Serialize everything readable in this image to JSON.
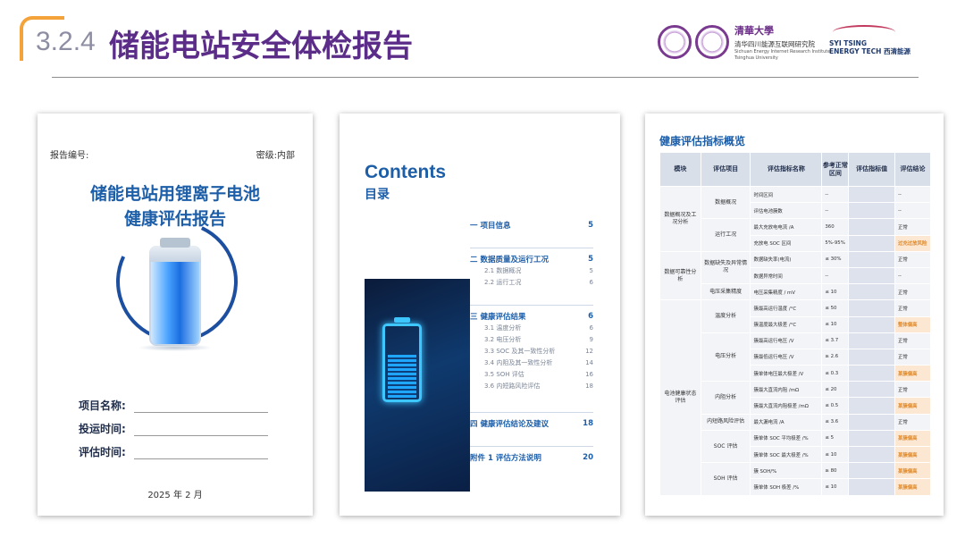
{
  "header": {
    "section_number": "3.2.4",
    "section_title": "储能电站安全体检报告",
    "institute_logo_text": "清華大學",
    "institute_cn": "清华四川能源互联网研究院",
    "institute_en_1": "Sichuan Energy Internet Research Institute",
    "institute_en_2": "Tsinghua University",
    "company_line1": "SYI TSING",
    "company_line2": "ENERGY TECH 西清能源"
  },
  "cover": {
    "report_no_label": "报告编号:",
    "secrecy_label": "密级:内部",
    "title_line1": "储能电站用锂离子电池",
    "title_line2": "健康评估报告",
    "fields": [
      "项目名称:",
      "投运时间:",
      "评估时间:"
    ],
    "date": "2025 年 2 月"
  },
  "contents": {
    "title_en": "Contents",
    "title_cn": "目录",
    "items": [
      {
        "num": "一",
        "label": "项目信息",
        "page": "5",
        "subs": []
      },
      {
        "num": "二",
        "label": "数据质量及运行工况",
        "page": "5",
        "subs": [
          {
            "label": "2.1 数据概况",
            "page": "5"
          },
          {
            "label": "2.2 运行工况",
            "page": "6"
          }
        ]
      },
      {
        "num": "三",
        "label": "健康评估结果",
        "page": "6",
        "subs": [
          {
            "label": "3.1 温度分析",
            "page": "6"
          },
          {
            "label": "3.2 电压分析",
            "page": "9"
          },
          {
            "label": "3.3 SOC 及其一致性分析",
            "page": "12"
          },
          {
            "label": "3.4 内阻及其一致性分析",
            "page": "14"
          },
          {
            "label": "3.5 SOH 评估",
            "page": "16"
          },
          {
            "label": "3.6 内短路风险评估",
            "page": "18"
          }
        ]
      },
      {
        "num": "四",
        "label": "健康评估结论及建议",
        "page": "18",
        "subs": []
      },
      {
        "num": "附件 1",
        "label": "评估方法说明",
        "page": "20",
        "subs": []
      }
    ]
  },
  "indicators": {
    "title": "健康评估指标概览",
    "headers": [
      "模块",
      "评估项目",
      "评估指标名称",
      "参考正常区间",
      "评估指标值",
      "评估结论"
    ],
    "rows": [
      {
        "module": "数据概况及工况分析",
        "item": "数据概况",
        "name": "时间区间",
        "range": "--",
        "value": "",
        "result": "--",
        "warn": false
      },
      {
        "module": "",
        "item": "",
        "name": "评估电池簇数",
        "range": "--",
        "value": "",
        "result": "--",
        "warn": false
      },
      {
        "module": "",
        "item": "运行工况",
        "name": "最大充放电电流 /A",
        "range": "360",
        "value": "",
        "result": "正常",
        "warn": false
      },
      {
        "module": "",
        "item": "",
        "name": "充放电 SOC 区间",
        "range": "5%-95%",
        "value": "",
        "result": "过充过放风险",
        "warn": true
      },
      {
        "module": "数据可靠性分析",
        "item": "数据缺失及异常情况",
        "name": "数据缺失率(电流)",
        "range": "≤ 30%",
        "value": "",
        "result": "正常",
        "warn": false
      },
      {
        "module": "",
        "item": "",
        "name": "数据异常时间",
        "range": "--",
        "value": "",
        "result": "--",
        "warn": false
      },
      {
        "module": "",
        "item": "电压采集精度",
        "name": "电压采集精度 / mV",
        "range": "≤ 10",
        "value": "",
        "result": "正常",
        "warn": false
      },
      {
        "module": "电池健康状态评估",
        "item": "温度分析",
        "name": "簇最高运行温度 /°C",
        "range": "≤ 50",
        "value": "",
        "result": "正常",
        "warn": false
      },
      {
        "module": "",
        "item": "",
        "name": "簇温度最大极差 /°C",
        "range": "≤ 10",
        "value": "",
        "result": "整体偏高",
        "warn": true
      },
      {
        "module": "",
        "item": "电压分析",
        "name": "簇最高运行电压 /V",
        "range": "≤ 3.7",
        "value": "",
        "result": "正常",
        "warn": false
      },
      {
        "module": "",
        "item": "",
        "name": "簇最低运行电压 /V",
        "range": "≥ 2.6",
        "value": "",
        "result": "正常",
        "warn": false
      },
      {
        "module": "",
        "item": "",
        "name": "簇单体电压最大极差 /V",
        "range": "≤ 0.3",
        "value": "",
        "result": "某簇偏高",
        "warn": true
      },
      {
        "module": "",
        "item": "内阻分析",
        "name": "簇最大直流内阻 /mΩ",
        "range": "≤ 20",
        "value": "",
        "result": "正常",
        "warn": false
      },
      {
        "module": "",
        "item": "",
        "name": "簇最大直流内阻极差 /mΩ",
        "range": "≤ 0.5",
        "value": "",
        "result": "某簇偏高",
        "warn": true
      },
      {
        "module": "",
        "item": "内短路风险评估",
        "name": "最大漏电流 /A",
        "range": "≤ 3.6",
        "value": "",
        "result": "正常",
        "warn": false
      },
      {
        "module": "",
        "item": "SOC 评估",
        "name": "簇单体 SOC 平均极差 /%",
        "range": "≤ 5",
        "value": "",
        "result": "某簇偏高",
        "warn": true
      },
      {
        "module": "",
        "item": "",
        "name": "簇单体 SOC 最大极差 /%",
        "range": "≤ 10",
        "value": "",
        "result": "某簇偏高",
        "warn": true
      },
      {
        "module": "",
        "item": "SOH 评估",
        "name": "簇 SOH/%",
        "range": "≥ 80",
        "value": "",
        "result": "某簇偏高",
        "warn": true
      },
      {
        "module": "",
        "item": "",
        "name": "簇单体 SOH 极差 /%",
        "range": "≤ 10",
        "value": "",
        "result": "某簇偏高",
        "warn": true
      }
    ]
  }
}
